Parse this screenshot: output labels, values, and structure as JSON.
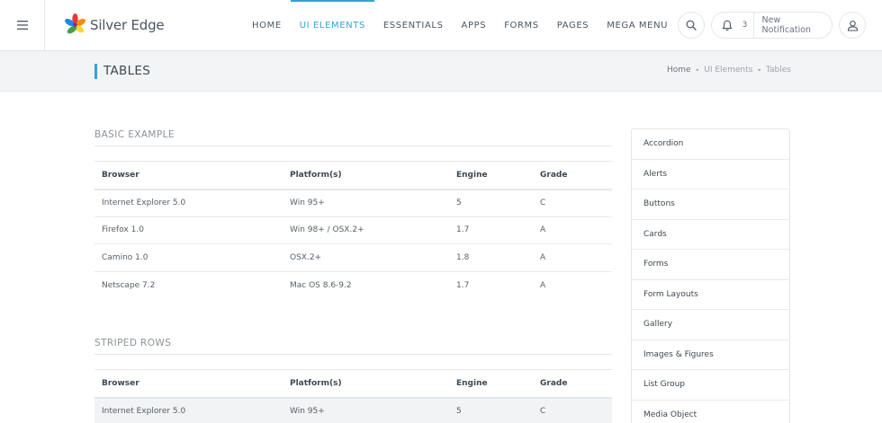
{
  "brand": {
    "name": "Silver Edge"
  },
  "nav": {
    "items": [
      {
        "label": "HOME"
      },
      {
        "label": "UI ELEMENTS"
      },
      {
        "label": "ESSENTIALS"
      },
      {
        "label": "APPS"
      },
      {
        "label": "FORMS"
      },
      {
        "label": "PAGES"
      },
      {
        "label": "MEGA MENU"
      }
    ],
    "active_index": 1
  },
  "header": {
    "notification_count": "3",
    "notification_label": "New Notification"
  },
  "page": {
    "title": "TABLES",
    "breadcrumb": [
      "Home",
      "UI Elements",
      "Tables"
    ]
  },
  "basic_example": {
    "title": "BASIC EXAMPLE",
    "columns": [
      "Browser",
      "Platform(s)",
      "Engine",
      "Grade"
    ],
    "rows": [
      [
        "Internet Explorer 5.0",
        "Win 95+",
        "5",
        "C"
      ],
      [
        "Firefox 1.0",
        "Win 98+ / OSX.2+",
        "1.7",
        "A"
      ],
      [
        "Camino 1.0",
        "OSX.2+",
        "1.8",
        "A"
      ],
      [
        "Netscape 7.2",
        "Mac OS 8.6-9.2",
        "1.7",
        "A"
      ]
    ]
  },
  "striped_rows": {
    "title": "STRIPED ROWS",
    "columns": [
      "Browser",
      "Platform(s)",
      "Engine",
      "Grade"
    ],
    "rows": [
      [
        "Internet Explorer 5.0",
        "Win 95+",
        "5",
        "C"
      ]
    ]
  },
  "side_menu": {
    "items": [
      "Accordion",
      "Alerts",
      "Buttons",
      "Cards",
      "Forms",
      "Form Layouts",
      "Gallery",
      "Images & Figures",
      "List Group",
      "Media Object"
    ]
  },
  "colors": {
    "accent": "#35a3d6",
    "titlebar_bg": "#f3f4f5",
    "stripe": "#f2f3f4"
  }
}
